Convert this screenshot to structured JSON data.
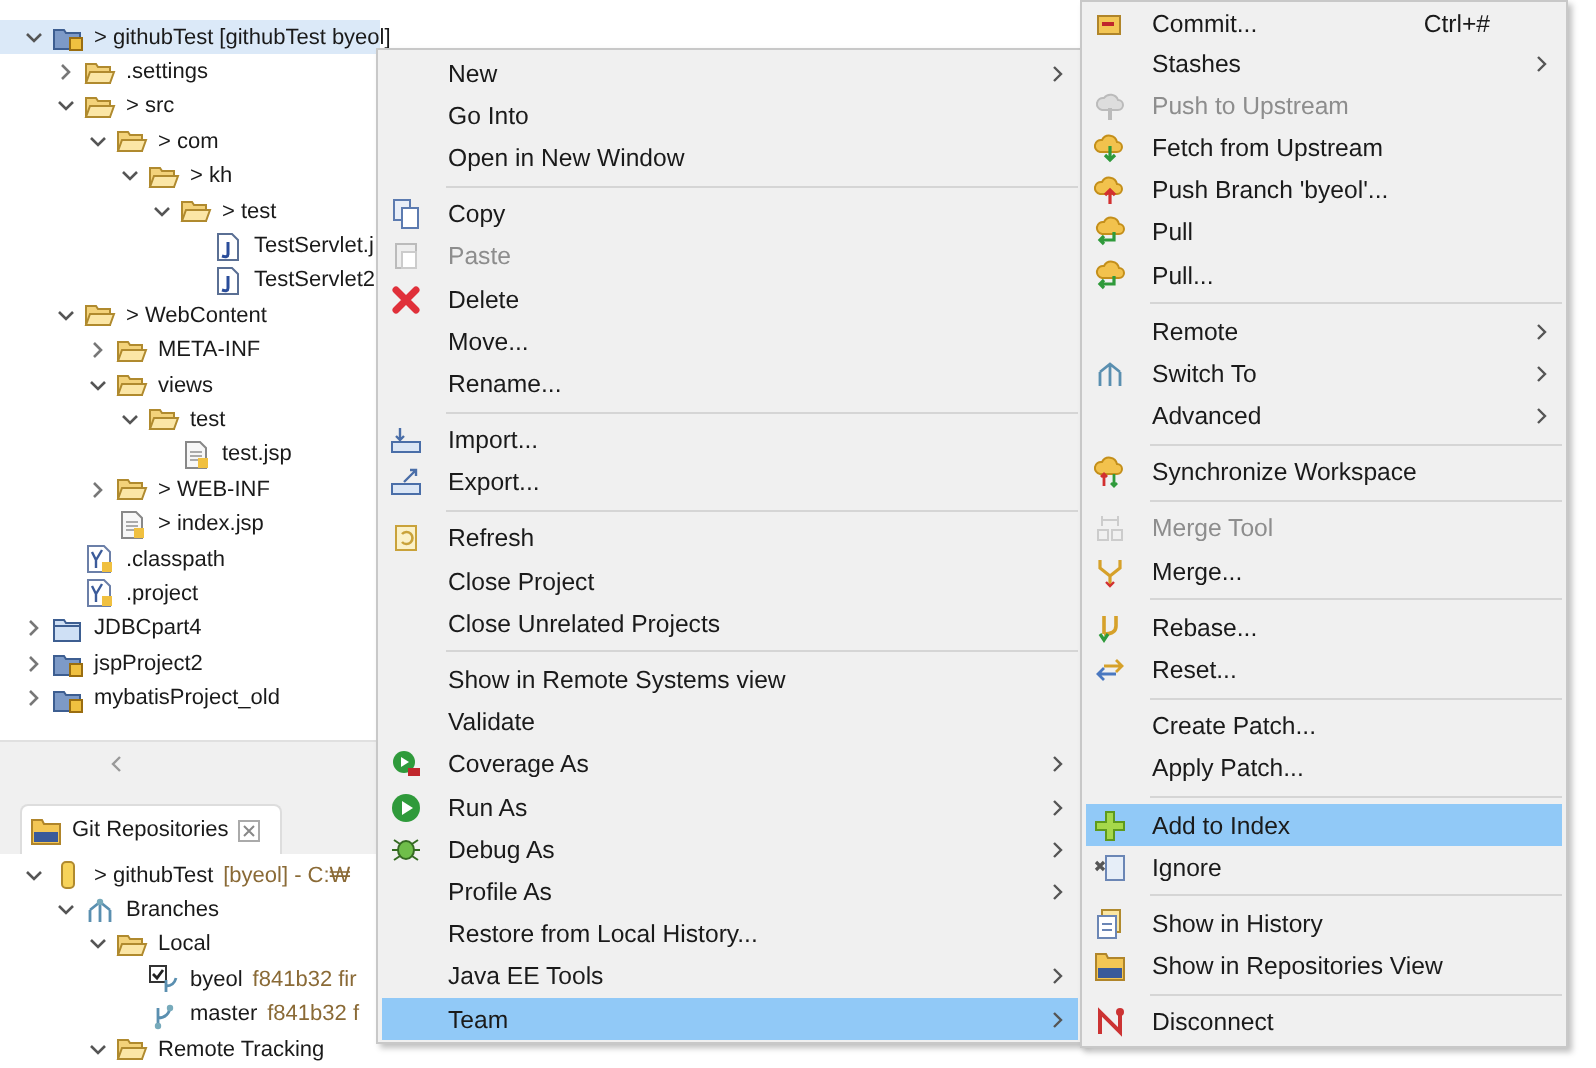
{
  "project_explorer": {
    "items": [
      {
        "label": "> githubTest [githubTest byeol]",
        "kind": "project",
        "expanded": true,
        "selected": true,
        "children": [
          {
            "label": ".settings",
            "kind": "folder",
            "expanded": false,
            "selected": false
          },
          {
            "label": "> src",
            "kind": "folder",
            "expanded": true,
            "selected": false,
            "children": [
              {
                "label": "> com",
                "kind": "folder",
                "expanded": true,
                "selected": false,
                "children": [
                  {
                    "label": "> kh",
                    "kind": "folder",
                    "expanded": true,
                    "selected": false,
                    "children": [
                      {
                        "label": "> test",
                        "kind": "folder",
                        "expanded": true,
                        "selected": false,
                        "children": [
                          {
                            "label": "TestServlet.j",
                            "kind": "java-file",
                            "selected": false
                          },
                          {
                            "label": "TestServlet2",
                            "kind": "java-file",
                            "selected": false
                          }
                        ]
                      }
                    ]
                  }
                ]
              }
            ]
          },
          {
            "label": "> WebContent",
            "kind": "folder",
            "expanded": true,
            "selected": false,
            "children": [
              {
                "label": "META-INF",
                "kind": "folder",
                "expanded": false,
                "selected": false
              },
              {
                "label": "views",
                "kind": "folder",
                "expanded": true,
                "selected": false,
                "children": [
                  {
                    "label": "test",
                    "kind": "folder",
                    "expanded": true,
                    "selected": false,
                    "children": [
                      {
                        "label": "test.jsp",
                        "kind": "text-file",
                        "selected": false
                      }
                    ]
                  }
                ]
              },
              {
                "label": "> WEB-INF",
                "kind": "folder",
                "expanded": false,
                "selected": false
              },
              {
                "label": "> index.jsp",
                "kind": "text-file",
                "selected": false
              }
            ]
          },
          {
            "label": ".classpath",
            "kind": "config-file",
            "selected": false
          },
          {
            "label": ".project",
            "kind": "config-file",
            "selected": false
          }
        ]
      },
      {
        "label": "JDBCpart4",
        "kind": "closed-project",
        "expanded": false,
        "selected": false
      },
      {
        "label": "jspProject2",
        "kind": "project",
        "expanded": false,
        "selected": false
      },
      {
        "label": "mybatisProject_old",
        "kind": "project",
        "expanded": false,
        "selected": false
      }
    ]
  },
  "git_repositories": {
    "title": "Git Repositories",
    "items": [
      {
        "label": "> githubTest",
        "detail": "[byeol] - C:₩",
        "kind": "repository",
        "expanded": true,
        "children": [
          {
            "label": "Branches",
            "kind": "branches",
            "expanded": true,
            "children": [
              {
                "label": "Local",
                "kind": "folder",
                "expanded": true,
                "children": [
                  {
                    "label": "byeol",
                    "detail": "f841b32 fir",
                    "kind": "checked-out-branch"
                  },
                  {
                    "label": "master",
                    "detail": "f841b32 f",
                    "kind": "branch"
                  }
                ]
              },
              {
                "label": "Remote Tracking",
                "kind": "folder",
                "expanded": true
              }
            ]
          }
        ]
      }
    ]
  },
  "context_menu": {
    "items": [
      {
        "kind": "item",
        "label": "New",
        "submenu": true,
        "disabled": false,
        "selected": false
      },
      {
        "kind": "item",
        "label": "Go Into",
        "submenu": false,
        "disabled": false,
        "selected": false
      },
      {
        "kind": "item",
        "label": "Open in New Window",
        "submenu": false,
        "disabled": false,
        "selected": false
      },
      {
        "kind": "separator"
      },
      {
        "kind": "item",
        "label": "Copy",
        "submenu": false,
        "disabled": false,
        "selected": false
      },
      {
        "kind": "item",
        "label": "Paste",
        "submenu": false,
        "disabled": true,
        "selected": false
      },
      {
        "kind": "item",
        "label": "Delete",
        "submenu": false,
        "disabled": false,
        "selected": false
      },
      {
        "kind": "item",
        "label": "Move...",
        "submenu": false,
        "disabled": false,
        "selected": false
      },
      {
        "kind": "item",
        "label": "Rename...",
        "submenu": false,
        "disabled": false,
        "selected": false
      },
      {
        "kind": "separator"
      },
      {
        "kind": "item",
        "label": "Import...",
        "submenu": false,
        "disabled": false,
        "selected": false
      },
      {
        "kind": "item",
        "label": "Export...",
        "submenu": false,
        "disabled": false,
        "selected": false
      },
      {
        "kind": "separator"
      },
      {
        "kind": "item",
        "label": "Refresh",
        "submenu": false,
        "disabled": false,
        "selected": false
      },
      {
        "kind": "item",
        "label": "Close Project",
        "submenu": false,
        "disabled": false,
        "selected": false
      },
      {
        "kind": "item",
        "label": "Close Unrelated Projects",
        "submenu": false,
        "disabled": false,
        "selected": false
      },
      {
        "kind": "separator"
      },
      {
        "kind": "item",
        "label": "Show in Remote Systems view",
        "submenu": false,
        "disabled": false,
        "selected": false
      },
      {
        "kind": "item",
        "label": "Validate",
        "submenu": false,
        "disabled": false,
        "selected": false
      },
      {
        "kind": "item",
        "label": "Coverage As",
        "submenu": true,
        "disabled": false,
        "selected": false
      },
      {
        "kind": "item",
        "label": "Run As",
        "submenu": true,
        "disabled": false,
        "selected": false
      },
      {
        "kind": "item",
        "label": "Debug As",
        "submenu": true,
        "disabled": false,
        "selected": false
      },
      {
        "kind": "item",
        "label": "Profile As",
        "submenu": true,
        "disabled": false,
        "selected": false
      },
      {
        "kind": "item",
        "label": "Restore from Local History...",
        "submenu": false,
        "disabled": false,
        "selected": false
      },
      {
        "kind": "item",
        "label": "Java EE Tools",
        "submenu": true,
        "disabled": false,
        "selected": false
      },
      {
        "kind": "item",
        "label": "Team",
        "submenu": true,
        "disabled": false,
        "selected": true
      }
    ]
  },
  "team_submenu": {
    "items": [
      {
        "kind": "item",
        "label": "Commit...",
        "shortcut": "Ctrl+#",
        "submenu": false,
        "disabled": false,
        "selected": false
      },
      {
        "kind": "item",
        "label": "Stashes",
        "submenu": true,
        "disabled": false,
        "selected": false
      },
      {
        "kind": "item",
        "label": "Push to Upstream",
        "submenu": false,
        "disabled": true,
        "selected": false
      },
      {
        "kind": "item",
        "label": "Fetch from Upstream",
        "submenu": false,
        "disabled": false,
        "selected": false
      },
      {
        "kind": "item",
        "label": "Push Branch 'byeol'...",
        "submenu": false,
        "disabled": false,
        "selected": false
      },
      {
        "kind": "item",
        "label": "Pull",
        "submenu": false,
        "disabled": false,
        "selected": false
      },
      {
        "kind": "item",
        "label": "Pull...",
        "submenu": false,
        "disabled": false,
        "selected": false
      },
      {
        "kind": "separator"
      },
      {
        "kind": "item",
        "label": "Remote",
        "submenu": true,
        "disabled": false,
        "selected": false
      },
      {
        "kind": "item",
        "label": "Switch To",
        "submenu": true,
        "disabled": false,
        "selected": false
      },
      {
        "kind": "item",
        "label": "Advanced",
        "submenu": true,
        "disabled": false,
        "selected": false
      },
      {
        "kind": "separator"
      },
      {
        "kind": "item",
        "label": "Synchronize Workspace",
        "submenu": false,
        "disabled": false,
        "selected": false
      },
      {
        "kind": "separator"
      },
      {
        "kind": "item",
        "label": "Merge Tool",
        "submenu": false,
        "disabled": true,
        "selected": false
      },
      {
        "kind": "item",
        "label": "Merge...",
        "submenu": false,
        "disabled": false,
        "selected": false
      },
      {
        "kind": "separator"
      },
      {
        "kind": "item",
        "label": "Rebase...",
        "submenu": false,
        "disabled": false,
        "selected": false
      },
      {
        "kind": "item",
        "label": "Reset...",
        "submenu": false,
        "disabled": false,
        "selected": false
      },
      {
        "kind": "separator"
      },
      {
        "kind": "item",
        "label": "Create Patch...",
        "submenu": false,
        "disabled": false,
        "selected": false
      },
      {
        "kind": "item",
        "label": "Apply Patch...",
        "submenu": false,
        "disabled": false,
        "selected": false
      },
      {
        "kind": "separator"
      },
      {
        "kind": "item",
        "label": "Add to Index",
        "submenu": false,
        "disabled": false,
        "selected": true
      },
      {
        "kind": "item",
        "label": "Ignore",
        "submenu": false,
        "disabled": false,
        "selected": false
      },
      {
        "kind": "separator"
      },
      {
        "kind": "item",
        "label": "Show in History",
        "submenu": false,
        "disabled": false,
        "selected": false
      },
      {
        "kind": "item",
        "label": "Show in Repositories View",
        "submenu": false,
        "disabled": false,
        "selected": false
      },
      {
        "kind": "separator"
      },
      {
        "kind": "item",
        "label": "Disconnect",
        "submenu": false,
        "disabled": false,
        "selected": false
      }
    ]
  }
}
